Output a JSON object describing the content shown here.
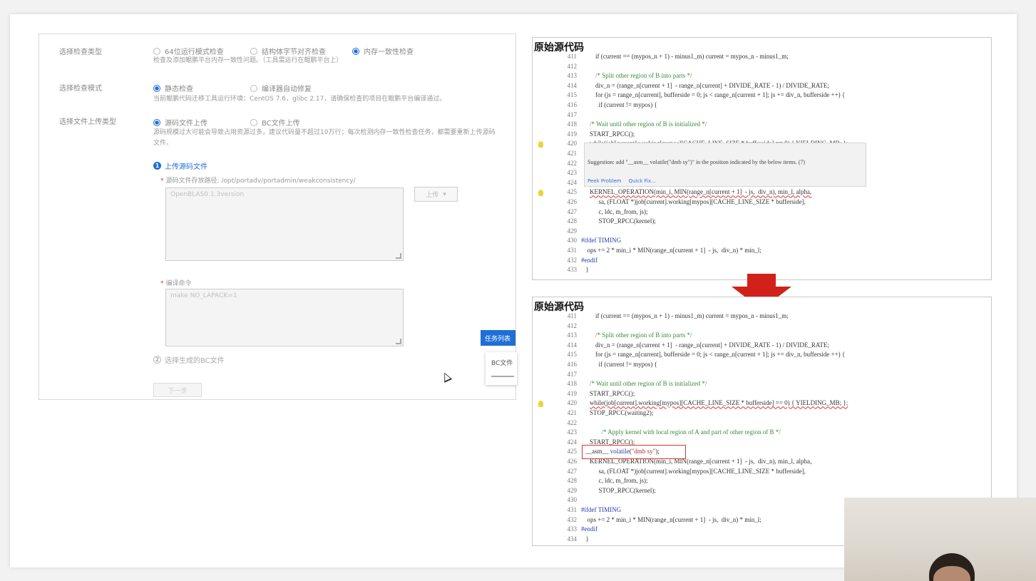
{
  "form": {
    "check_type": {
      "label": "选择检查类型",
      "options": [
        "64位运行模式检查",
        "结构体字节对齐检查",
        "内存一致性检查"
      ],
      "selected": 2,
      "hint": "检查及添加鲲鹏平台内存一致性问题。（工具需运行在鲲鹏平台上）"
    },
    "check_mode": {
      "label": "选择检查模式",
      "options": [
        "静态检查",
        "编译器自动修复"
      ],
      "selected": 0,
      "hint": "当前鲲鹏代码迁移工具运行环境：CentOS 7.6，glibc 2.17，请确保检查的项目在鲲鹏平台编译通过。"
    },
    "upload_type": {
      "label": "选择文件上传类型",
      "options": [
        "源码文件上传",
        "BC文件上传"
      ],
      "selected": 0,
      "hint_line1": "源码规模过大可能会导致占用资源过多，建议代码量不超过10万行；每次检测内存一致性检查任务，都需要重新上传源码",
      "hint_line2": "文件。"
    },
    "upload_source": {
      "step_label": "上传源码文件",
      "step_num": "1",
      "path_label": "源码文件存放路径: /opt/portadv/portadmin/weakconsistency/",
      "path_placeholder": "OpenBLAS0.1.3version",
      "upload_button": "上传",
      "compile_label": "编译命令",
      "compile_placeholder": "make NO_LAPACK=1"
    },
    "step2": {
      "num": "2",
      "label": "选择生成的BC文件"
    },
    "next_button": "下一步",
    "task_tab": "任务列表",
    "bc_card": "BC文件"
  },
  "top_panel": {
    "title": "原始源代码",
    "tooltip": {
      "message": "Suggestion: add \"__asm__ volatile(\"dmb sy\")\" in the position indicated by the below items. (7)",
      "actions": [
        "Peek Problem",
        "Quick Fix..."
      ]
    },
    "lines": [
      {
        "n": "411",
        "t": "if (current == (mypos_n + 1) - minus1_m) current = mypos_n - minus1_m;",
        "x": 88,
        "cls": ""
      },
      {
        "n": "412",
        "t": "",
        "x": 88,
        "cls": ""
      },
      {
        "n": "413",
        "t": "/* Split other region of B into parts */",
        "x": 88,
        "cls": "c"
      },
      {
        "n": "414",
        "t": "div_n = (range_n[current + 1]  - range_n[current] + DIVIDE_RATE - 1) / DIVIDE_RATE;",
        "x": 88,
        "cls": ""
      },
      {
        "n": "415",
        "t": "for (js = range_n[current], bufferside = 0; js < range_n[current + 1]; js += div_n, bufferside ++) {",
        "x": 88,
        "cls": ""
      },
      {
        "n": "416",
        "t": "  if (current != mypos) {",
        "x": 88,
        "cls": ""
      },
      {
        "n": "417",
        "t": "",
        "x": 88,
        "cls": ""
      },
      {
        "n": "418",
        "t": "/* Wait until other region of B is initialized */",
        "x": 80,
        "cls": "c"
      },
      {
        "n": "419",
        "t": "START_RPCC();",
        "x": 80,
        "cls": ""
      },
      {
        "n": "420",
        "t": "while(job[current].working[mypos][CACHE_LINE_SIZE * bufferside] == 0) { YIELDING_MB; };",
        "x": 80,
        "cls": "w"
      },
      {
        "n": "421",
        "t": "",
        "x": 80,
        "cls": ""
      },
      {
        "n": "422",
        "t": "",
        "x": 80,
        "cls": ""
      },
      {
        "n": "423",
        "t": "",
        "x": 80,
        "cls": ""
      },
      {
        "n": "424",
        "t": "",
        "x": 80,
        "cls": ""
      },
      {
        "n": "425",
        "t": "KERNEL_OPERATION(min_i, MIN(range_n[current + 1]  - js,  div_n), min_l, alpha,",
        "x": 80,
        "cls": "w"
      },
      {
        "n": "426",
        "t": "  sa, (FLOAT *)job[current].working[mypos][CACHE_LINE_SIZE * bufferside],",
        "x": 88,
        "cls": ""
      },
      {
        "n": "427",
        "t": "  c, ldc, m_from, js);",
        "x": 88,
        "cls": ""
      },
      {
        "n": "428",
        "t": "  STOP_RPCC(kernel);",
        "x": 88,
        "cls": ""
      },
      {
        "n": "429",
        "t": "",
        "x": 88,
        "cls": ""
      },
      {
        "n": "430",
        "t": "#ifdef TIMING",
        "x": 68,
        "cls": "k"
      },
      {
        "n": "431",
        "t": "  ops += 2 * min_i * MIN(range_n[current + 1]  - js,  div_n) * min_l;",
        "x": 72,
        "cls": ""
      },
      {
        "n": "432",
        "t": "#endif",
        "x": 68,
        "cls": "k"
      },
      {
        "n": "433",
        "t": "  }",
        "x": 70,
        "cls": ""
      }
    ]
  },
  "bottom_panel": {
    "title": "原始源代码",
    "lines": [
      {
        "n": "411",
        "t": "if (current == (mypos_n + 1) - minus1_m) current = mypos_n - minus1_m;",
        "x": 88,
        "cls": ""
      },
      {
        "n": "412",
        "t": "",
        "x": 88,
        "cls": ""
      },
      {
        "n": "413",
        "t": "/* Split other region of B into parts */",
        "x": 88,
        "cls": "c"
      },
      {
        "n": "414",
        "t": "div_n = (range_n[current + 1]  - range_n[current] + DIVIDE_RATE - 1) / DIVIDE_RATE;",
        "x": 88,
        "cls": ""
      },
      {
        "n": "415",
        "t": "for (js = range_n[current], bufferside = 0; js < range_n[current + 1]; js += div_n, bufferside ++) {",
        "x": 88,
        "cls": ""
      },
      {
        "n": "416",
        "t": "  if (current != mypos) {",
        "x": 88,
        "cls": ""
      },
      {
        "n": "417",
        "t": "",
        "x": 88,
        "cls": ""
      },
      {
        "n": "418",
        "t": "/* Wait until other region of B is initialized */",
        "x": 80,
        "cls": "c"
      },
      {
        "n": "419",
        "t": "START_RPCC();",
        "x": 80,
        "cls": ""
      },
      {
        "n": "420",
        "t": "while(job[current].working[mypos][CACHE_LINE_SIZE * bufferside] == 0) { YIELDING_MB; };",
        "x": 80,
        "cls": "w"
      },
      {
        "n": "421",
        "t": "STOP_RPCC(waiting2);",
        "x": 80,
        "cls": ""
      },
      {
        "n": "422",
        "t": "",
        "x": 80,
        "cls": ""
      },
      {
        "n": "423",
        "t": "  /* Apply kernel with local region of A and part of other region of B */",
        "x": 92,
        "cls": "c"
      },
      {
        "n": "424",
        "t": "START_RPCC();",
        "x": 80,
        "cls": ""
      },
      {
        "n": "425",
        "t": "__asm__ volatile(\"dmb sy\");",
        "x": 74,
        "cls": "asm"
      },
      {
        "n": "426",
        "t": "KERNEL_OPERATION(min_i, MIN(range_n[current + 1]  - js,  div_n), min_l, alpha,",
        "x": 80,
        "cls": ""
      },
      {
        "n": "427",
        "t": "  sa, (FLOAT *)job[current].working[mypos][CACHE_LINE_SIZE * bufferside],",
        "x": 88,
        "cls": ""
      },
      {
        "n": "428",
        "t": "  c, ldc, m_from, js);",
        "x": 88,
        "cls": ""
      },
      {
        "n": "429",
        "t": "  STOP_RPCC(kernel);",
        "x": 88,
        "cls": ""
      },
      {
        "n": "430",
        "t": "",
        "x": 88,
        "cls": ""
      },
      {
        "n": "431",
        "t": "#ifdef TIMING",
        "x": 68,
        "cls": "k"
      },
      {
        "n": "432",
        "t": "  ops += 2 * min_i * MIN(range_n[current + 1]  - js,  div_n) * min_l;",
        "x": 72,
        "cls": ""
      },
      {
        "n": "433",
        "t": "#endif",
        "x": 68,
        "cls": "k"
      },
      {
        "n": "434",
        "t": "  }",
        "x": 70,
        "cls": ""
      }
    ]
  },
  "colors": {
    "accent": "#1f6fd6",
    "arrow": "#d0211b",
    "comment": "#3a8a3a",
    "highlight_box": "#dd3333"
  }
}
